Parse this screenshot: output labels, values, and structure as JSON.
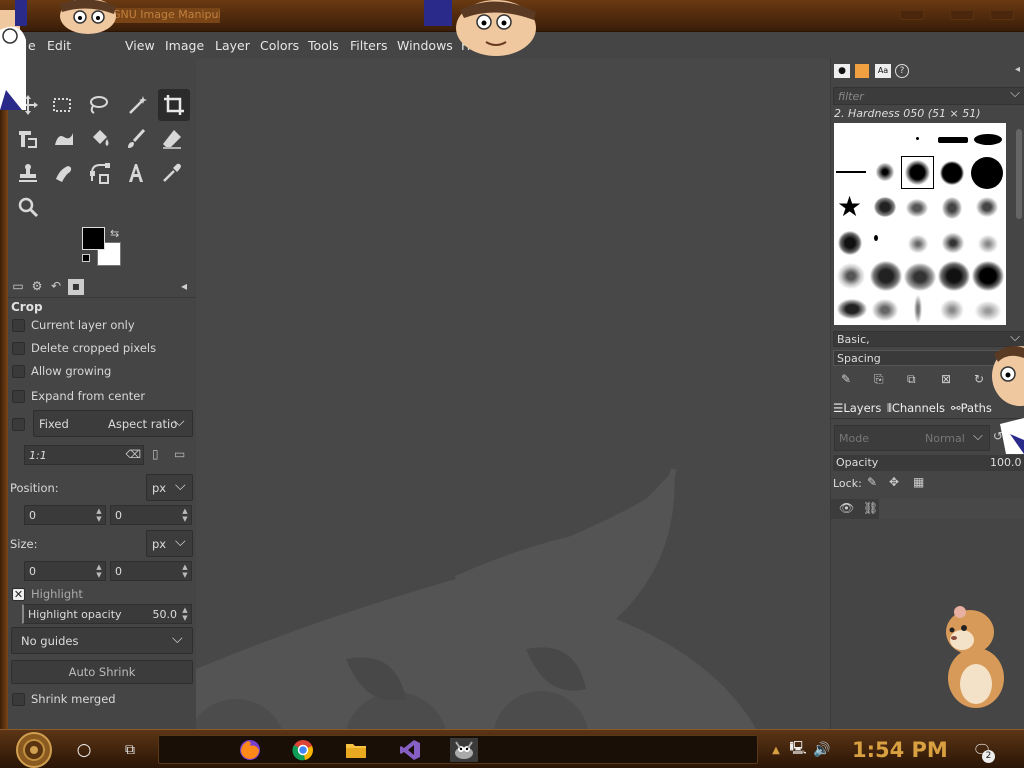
{
  "window": {
    "title": "GNU Image Manipulation Program"
  },
  "menu": [
    "Edit",
    "View",
    "Image",
    "Layer",
    "Colors",
    "Tools",
    "Filters",
    "Windows",
    "Help"
  ],
  "menu_partial": "e",
  "tool_options": {
    "title": "Crop",
    "current_layer_only": "Current layer only",
    "delete_cropped": "Delete cropped pixels",
    "allow_growing": "Allow growing",
    "expand_center": "Expand from center",
    "fixed": "Fixed",
    "aspect": "Aspect ratio",
    "ratio_value": "1:1",
    "position_label": "Position:",
    "position_unit": "px",
    "pos_x": "0",
    "pos_y": "0",
    "size_label": "Size:",
    "size_unit": "px",
    "size_w": "0",
    "size_h": "0",
    "highlight": "Highlight",
    "highlight_opacity_label": "Highlight opacity",
    "highlight_opacity_value": "50.0",
    "guides": "No guides",
    "auto_shrink": "Auto Shrink",
    "shrink_merged": "Shrink merged"
  },
  "brushes": {
    "filter_placeholder": "filter",
    "current": "2. Hardness 050 (51 × 51)",
    "tag": "Basic,",
    "spacing": "Spacing"
  },
  "layers": {
    "tab_layers": "Layers",
    "tab_channels": "Channels",
    "tab_paths": "Paths",
    "mode_label": "Mode",
    "mode_value": "Normal",
    "opacity_label": "Opacity",
    "opacity_value": "100.0",
    "lock_label": "Lock:"
  },
  "taskbar": {
    "clock": "1:54 PM",
    "notifications": "2"
  },
  "colors": {
    "accent_clock": "#d8a040",
    "wood": "#5c3515",
    "panel": "#454545"
  }
}
